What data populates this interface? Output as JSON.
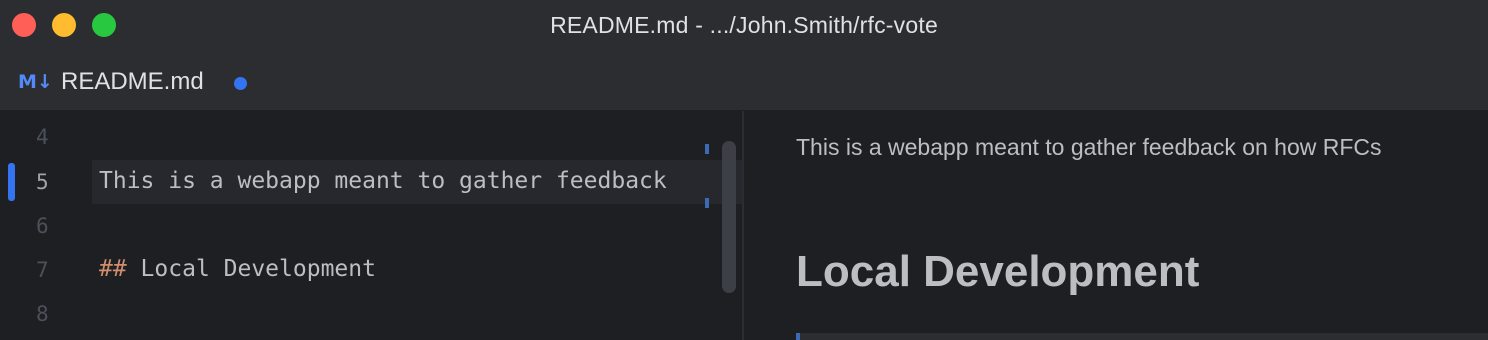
{
  "window": {
    "title": "README.md - .../John.Smith/rfc-vote"
  },
  "tabs": [
    {
      "icon": "M↓",
      "icon_name": "markdown-icon",
      "label": "README.md",
      "modified": true
    }
  ],
  "editor": {
    "lines": [
      {
        "number": "4",
        "text": ""
      },
      {
        "number": "5",
        "text": "This is a webapp meant to gather feedback",
        "active": true
      },
      {
        "number": "6",
        "text": ""
      },
      {
        "number": "7",
        "hash": "##",
        "text": " Local Development"
      },
      {
        "number": "8",
        "text": ""
      }
    ]
  },
  "preview": {
    "paragraph": "This is a webapp meant to gather feedback on how RFCs",
    "heading": "Local Development"
  },
  "colors": {
    "accent": "#3574f0",
    "markdown_heading_marker": "#cf8e6d",
    "traffic_close": "#ff5f57",
    "traffic_minimize": "#febc2e",
    "traffic_maximize": "#28c840"
  }
}
